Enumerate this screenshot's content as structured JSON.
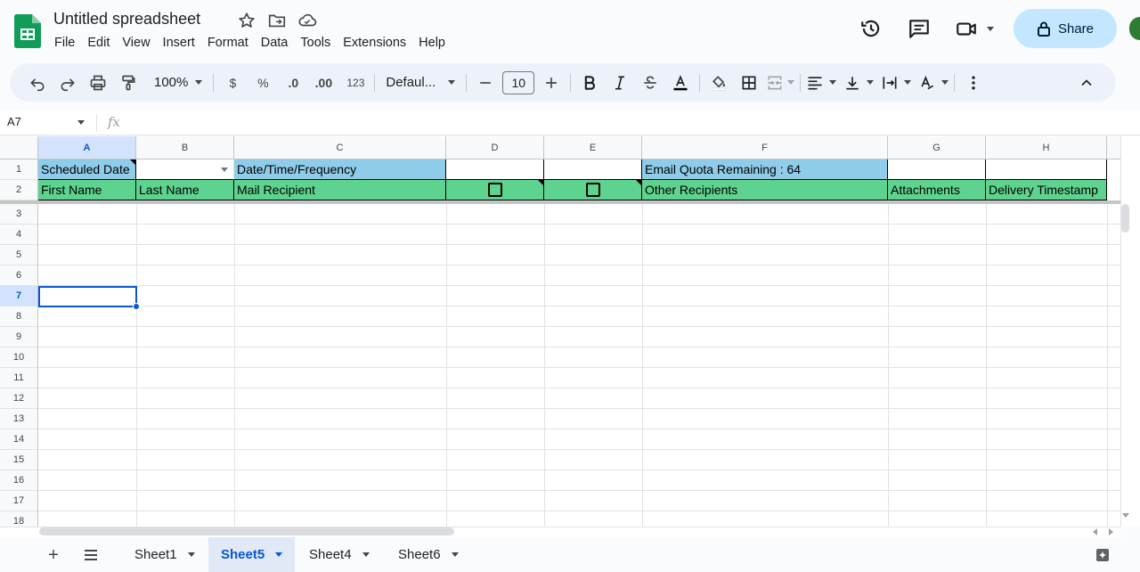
{
  "app": {
    "title": "Untitled spreadsheet",
    "menu": [
      "File",
      "Edit",
      "View",
      "Insert",
      "Format",
      "Data",
      "Tools",
      "Extensions",
      "Help"
    ],
    "share_label": "Share"
  },
  "toolbar": {
    "zoom": "100%",
    "currency": "$",
    "percent": "%",
    "decrease_decimal": ".0",
    "increase_decimal": ".00",
    "more_formats": "123",
    "font": "Defaul...",
    "font_size": "10"
  },
  "formula_bar": {
    "name_box": "A7",
    "fx": "fx",
    "value": ""
  },
  "grid": {
    "columns": [
      "A",
      "B",
      "C",
      "D",
      "E",
      "F",
      "G",
      "H"
    ],
    "selected_column": "A",
    "rows": [
      "1",
      "2",
      "3",
      "4",
      "5",
      "6",
      "7",
      "8",
      "9",
      "10",
      "11",
      "12",
      "13",
      "14",
      "15",
      "16",
      "17",
      "18"
    ],
    "selected_row": "7",
    "row1": {
      "A": "Scheduled Date",
      "B": "",
      "C": "Date/Time/Frequency",
      "D": "",
      "E": "",
      "F": "Email Quota Remaining : 64",
      "G": "",
      "H": ""
    },
    "row2": {
      "A": "First Name",
      "B": "Last Name",
      "C": "Mail Recipient",
      "D": "",
      "E": "",
      "F": "Other Recipients",
      "G": "Attachments",
      "H": "Delivery Timestamp"
    },
    "header_colors": {
      "row1": "#8fcce9",
      "row2": "#5ed38f"
    }
  },
  "sheets": {
    "tabs": [
      "Sheet1",
      "Sheet5",
      "Sheet4",
      "Sheet6"
    ],
    "active": "Sheet5"
  },
  "icons": [
    "sheets-logo-icon",
    "star-icon",
    "move-folder-icon",
    "cloud-saved-icon",
    "history-icon",
    "comment-icon",
    "meet-icon",
    "lock-icon",
    "undo-icon",
    "redo-icon",
    "print-icon",
    "paint-format-icon",
    "bold-icon",
    "italic-icon",
    "strikethrough-icon",
    "text-color-icon",
    "fill-color-icon",
    "borders-icon",
    "merge-icon",
    "align-icon",
    "valign-icon",
    "wrap-icon",
    "rotate-icon",
    "more-icon",
    "collapse-icon",
    "add-sheet-icon",
    "all-sheets-icon",
    "explore-icon"
  ]
}
